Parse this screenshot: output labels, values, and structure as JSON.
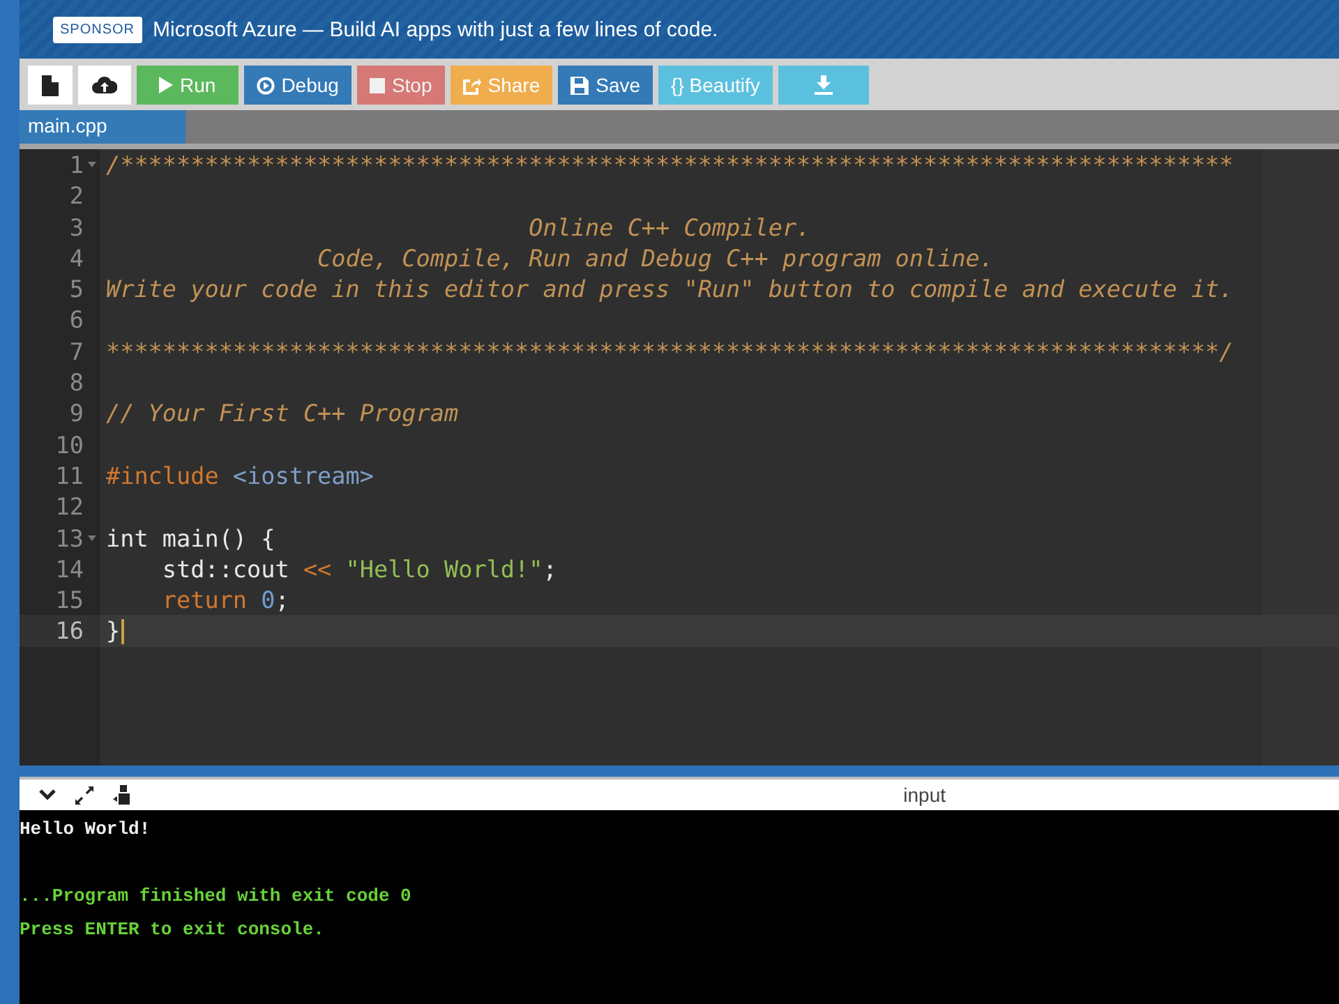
{
  "sponsor": {
    "badge": "SPONSOR",
    "text": "Microsoft Azure — Build AI apps with just a few lines of code."
  },
  "toolbar": [
    {
      "kind": "new-file",
      "disabled": false
    },
    {
      "kind": "upload",
      "disabled": false
    },
    {
      "kind": "run",
      "label": "Run",
      "disabled": false
    },
    {
      "kind": "debug",
      "label": "Debug",
      "disabled": false
    },
    {
      "kind": "stop",
      "label": "Stop",
      "disabled": true
    },
    {
      "kind": "share",
      "label": "Share",
      "disabled": false
    },
    {
      "kind": "save",
      "label": "Save",
      "disabled": false
    },
    {
      "kind": "beautify",
      "label": "{} Beautify",
      "disabled": false
    },
    {
      "kind": "download",
      "disabled": false
    }
  ],
  "tabs": [
    {
      "label": "main.cpp",
      "selected": true
    }
  ],
  "editor": {
    "lines": [
      {
        "number": "1",
        "foldable": true,
        "active": false,
        "tokens": [
          {
            "kind": "comment",
            "text": "/*******************************************************************************"
          }
        ]
      },
      {
        "number": "2",
        "foldable": false,
        "active": false
      },
      {
        "number": "3",
        "foldable": false,
        "active": false,
        "tokens": [
          {
            "kind": "comment",
            "text": "                              Online C++ Compiler."
          }
        ]
      },
      {
        "number": "4",
        "foldable": false,
        "active": false,
        "tokens": [
          {
            "kind": "comment",
            "text": "               Code, Compile, Run and Debug C++ program online."
          }
        ]
      },
      {
        "number": "5",
        "foldable": false,
        "active": false,
        "tokens": [
          {
            "kind": "comment",
            "text": "Write your code in this editor and press \"Run\" button to compile and execute it."
          }
        ]
      },
      {
        "number": "6",
        "foldable": false,
        "active": false
      },
      {
        "number": "7",
        "foldable": false,
        "active": false,
        "tokens": [
          {
            "kind": "comment",
            "text": "*******************************************************************************/"
          }
        ]
      },
      {
        "number": "8",
        "foldable": false,
        "active": false
      },
      {
        "number": "9",
        "foldable": false,
        "active": false,
        "tokens": [
          {
            "kind": "comment",
            "text": "// Your First C++ Program"
          }
        ]
      },
      {
        "number": "10",
        "foldable": false,
        "active": false
      },
      {
        "number": "11",
        "foldable": false,
        "active": false,
        "tokens": [
          {
            "kind": "keyword",
            "text": "#include"
          },
          {
            "kind": "library",
            "text": " <iostream>"
          }
        ]
      },
      {
        "number": "12",
        "foldable": false,
        "active": false
      },
      {
        "number": "13",
        "foldable": true,
        "active": false,
        "tokens": [
          {
            "kind": "plain",
            "text": "int main() {"
          }
        ]
      },
      {
        "number": "14",
        "foldable": false,
        "active": false,
        "tokens": [
          {
            "kind": "plain",
            "text": "    std::cout "
          },
          {
            "kind": "keyword",
            "text": "<<"
          },
          {
            "kind": "string",
            "text": " \"Hello World!\""
          },
          {
            "kind": "plain",
            "text": ";"
          }
        ]
      },
      {
        "number": "15",
        "foldable": false,
        "active": false,
        "tokens": [
          {
            "kind": "keyword",
            "text": "    return"
          },
          {
            "kind": "number",
            "text": " 0"
          },
          {
            "kind": "plain",
            "text": ";"
          }
        ]
      },
      {
        "number": "16",
        "foldable": false,
        "active": true,
        "tokens": [
          {
            "kind": "plain",
            "text": "}"
          }
        ]
      }
    ]
  },
  "console": {
    "input_label": "input",
    "lines": [
      {
        "kind": "output",
        "text": "Hello World!"
      },
      {
        "kind": "blank"
      },
      {
        "kind": "status",
        "text": "...Program finished with exit code 0"
      },
      {
        "kind": "status",
        "text": "Press ENTER to exit console."
      }
    ]
  }
}
